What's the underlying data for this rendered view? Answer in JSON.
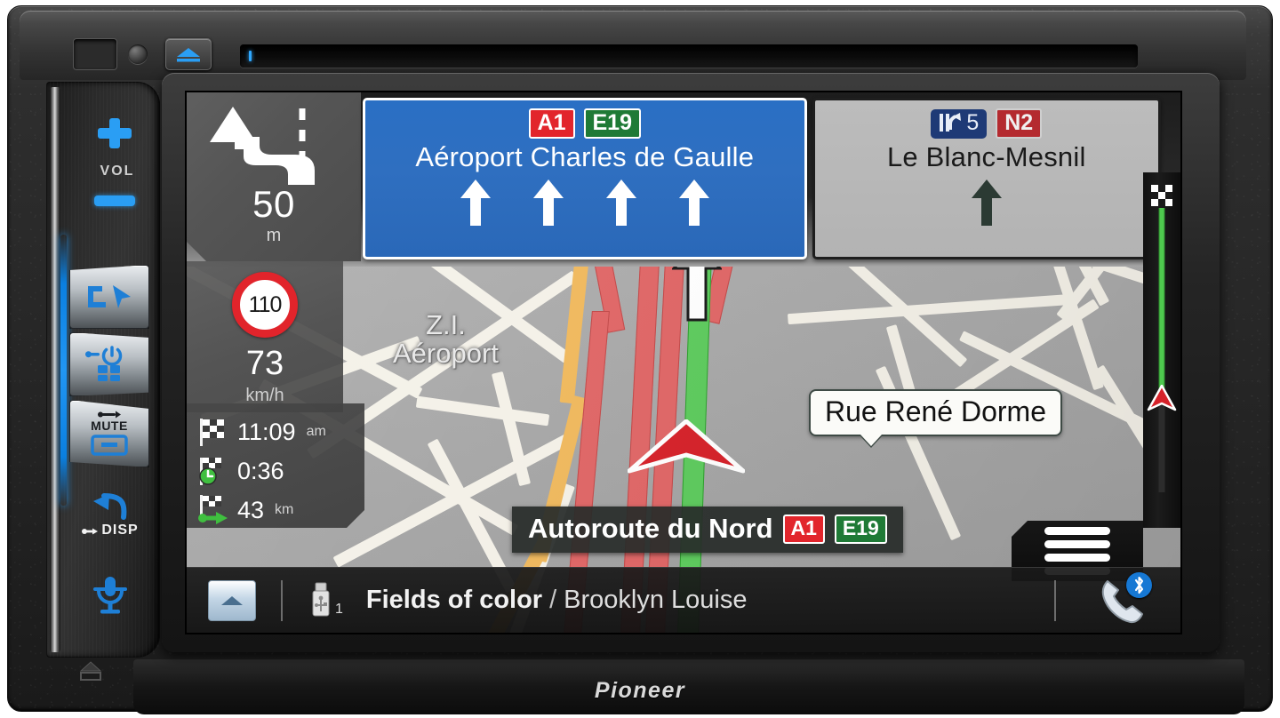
{
  "device": {
    "brand": "Pioneer",
    "top_controls": {
      "reset_slot": "reset-slot",
      "micro_button": "micro-button",
      "eject_label": "eject",
      "disc_slot": "disc-slot"
    },
    "side_buttons": {
      "vol_label": "VOL",
      "vol_up": "volume-up",
      "vol_down": "volume-down",
      "nav_button": "navigation",
      "power_apps_button": "power-apps",
      "mute_label": "MUTE",
      "disp_label": "DISP",
      "voice_button": "voice-recognition",
      "home_button": "home"
    }
  },
  "screen": {
    "maneuver": {
      "distance": "50",
      "unit": "m",
      "icon": "exit-left-arrow"
    },
    "speed": {
      "limit": "110",
      "current": "73",
      "unit": "km/h"
    },
    "eta": {
      "arrival_time": "11:09",
      "arrival_meridiem": "am",
      "remaining_time": "0:36",
      "remaining_distance": "43",
      "distance_unit": "km"
    },
    "signs": [
      {
        "style": "blue",
        "destination": "Aéroport Charles de Gaulle",
        "shields": [
          "A1",
          "E19"
        ],
        "lane_arrows": 4
      },
      {
        "style": "grey",
        "destination": "Le Blanc-Mesnil",
        "exit_number": "5",
        "shields": [
          "N2"
        ],
        "lane_arrows": 1
      }
    ],
    "map": {
      "area_label_line1": "Z.I.",
      "area_label_line2": "Aéroport",
      "callout_street": "Rue René Dorme",
      "current_road": "Autoroute du Nord",
      "current_road_shields": [
        "A1",
        "E19"
      ]
    },
    "menu_button": "menu",
    "media": {
      "eject_label": "eject",
      "source_icon": "usb-icon",
      "source_number": "1",
      "title": "Fields of color",
      "separator": "/",
      "artist": "Brooklyn Louise",
      "phone_icon": "phone-icon",
      "bluetooth_icon": "bluetooth-icon"
    }
  },
  "colors": {
    "sign_blue": "#2a6fc4",
    "shield_red": "#e2252c",
    "shield_green": "#1f7a36",
    "exit_blue": "#1e3a76",
    "shield_n_red": "#b42a2f",
    "route_green": "#5ecb5e",
    "route_red": "#e06767",
    "map_bg": "#a8a8a8",
    "road_white": "#f4f1e8",
    "road_orange": "#f0b95e",
    "limit_red": "#e1242b",
    "accent_blue": "#2a9ef4"
  }
}
